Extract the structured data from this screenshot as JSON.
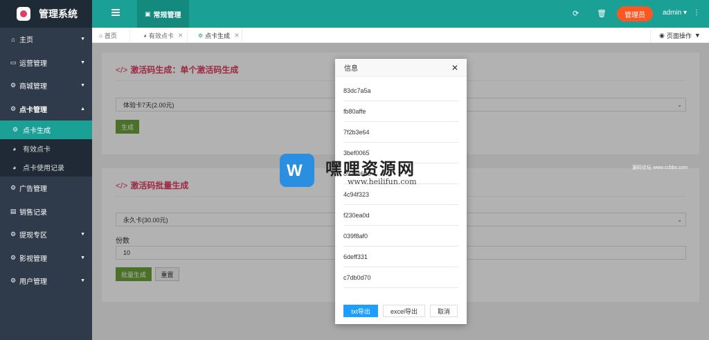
{
  "app": {
    "title": "管理系统"
  },
  "sidebar": {
    "items": [
      {
        "label": "主页",
        "icon": "home-icon",
        "has_arrow": true
      },
      {
        "label": "运营管理",
        "icon": "window-icon",
        "has_arrow": true
      },
      {
        "label": "商城管理",
        "icon": "gears-icon",
        "has_arrow": true
      },
      {
        "label": "点卡管理",
        "icon": "gears-icon",
        "has_arrow": true,
        "open": true
      },
      {
        "label": "广告管理",
        "icon": "gears-icon",
        "has_arrow": false
      },
      {
        "label": "销售记录",
        "icon": "document-icon",
        "has_arrow": false
      },
      {
        "label": "提现专区",
        "icon": "gears-icon",
        "has_arrow": true
      },
      {
        "label": "影视管理",
        "icon": "gears-icon",
        "has_arrow": true
      },
      {
        "label": "用户管理",
        "icon": "gears-icon",
        "has_arrow": true
      }
    ],
    "sub_items": [
      {
        "label": "点卡生成",
        "active": true
      },
      {
        "label": "有效点卡",
        "active": false
      },
      {
        "label": "点卡使用记录",
        "active": false
      }
    ]
  },
  "header": {
    "tab_label": "常规管理",
    "role_label": "管理员",
    "user_label": "admin"
  },
  "tabs": {
    "items": [
      {
        "label": "首页",
        "icon": "home-icon"
      },
      {
        "label": "有效点卡",
        "icon": "gauge-icon"
      },
      {
        "label": "点卡生成",
        "icon": "gears-icon"
      }
    ],
    "page_ops_label": "页面操作"
  },
  "single": {
    "title": "激活码生成：单个激活码生成",
    "select_value": "体验卡7天(2.00元)",
    "button_label": "生成"
  },
  "batch": {
    "title": "激活码批量生成",
    "select_value": "永久卡(30.00元)",
    "count_label": "份数",
    "count_value": "10",
    "submit_label": "批量生成",
    "reset_label": "重置"
  },
  "dialog": {
    "title": "信息",
    "codes": [
      "83dc7a5a",
      "fb80affe",
      "7f2b3e64",
      "3bef0065",
      "8976c600",
      "4c94f323",
      "f230ea0d",
      "039f8af0",
      "6deff331",
      "c7db0d70"
    ],
    "txt_export_label": "txt导出",
    "excel_export_label": "excel导出",
    "cancel_label": "取消"
  },
  "watermark": {
    "title": "嘿哩资源网",
    "url": "www.heilifun.com",
    "side_text": "源码论坛 www.ccbbs.com"
  },
  "colors": {
    "sidebar": "#2f3b4a",
    "header": "#1aa094",
    "accent_red": "#e23a5e",
    "role_button": "#ff5722",
    "primary_blue": "#1e9fff",
    "green_button": "#6ba339"
  }
}
